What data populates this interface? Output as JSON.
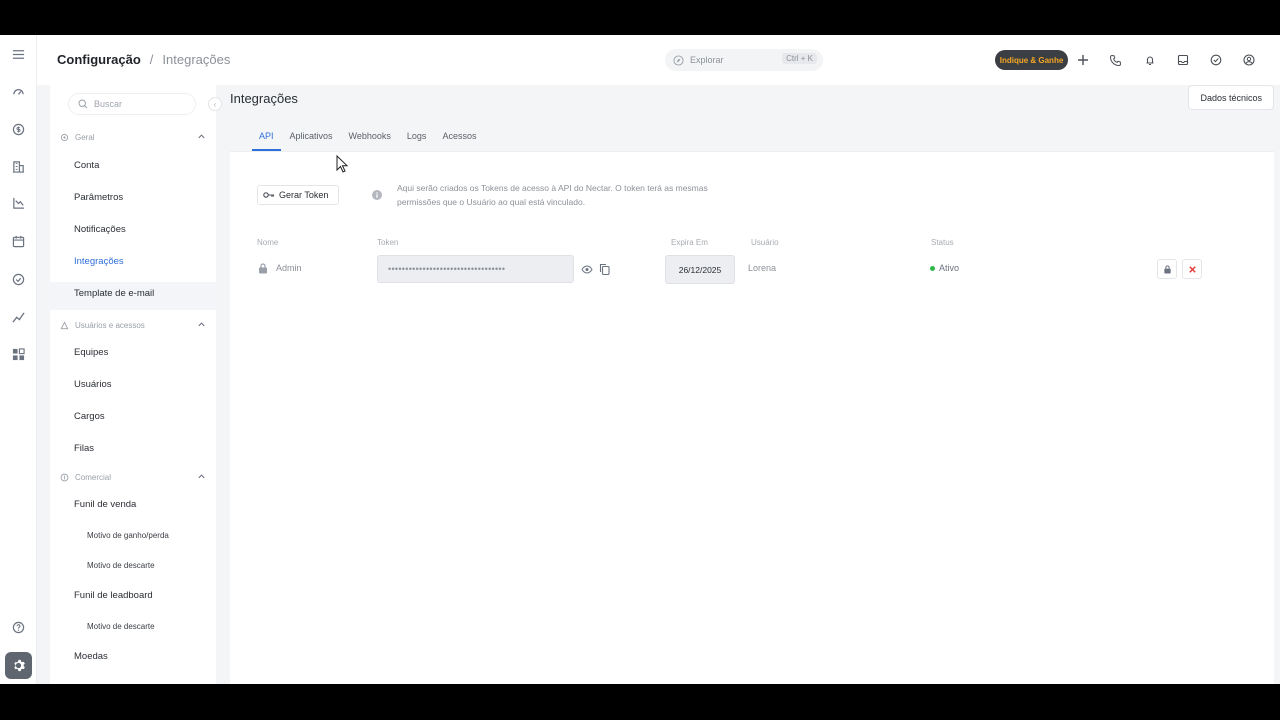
{
  "breadcrumb": {
    "parent": "Configuração",
    "separator": "/",
    "current": "Integrações"
  },
  "topbar": {
    "search_placeholder": "Explorar",
    "search_shortcut": "Ctrl + K",
    "indique_label": "Indique & Ganhe",
    "icons": [
      "plus-icon",
      "phone-icon",
      "bell-icon",
      "inbox-icon",
      "task-check-icon",
      "user-avatar-icon"
    ]
  },
  "rail": {
    "icons": [
      "menu-icon",
      "dashboard-icon",
      "money-icon",
      "building-icon",
      "chart-icon",
      "calendar-icon",
      "check-circle-icon",
      "trend-icon",
      "widgets-icon",
      "help-icon",
      "settings-icon"
    ]
  },
  "sidebar": {
    "search_placeholder": "Buscar",
    "sections": {
      "geral": "Geral",
      "usuarios": "Usuários e acessos",
      "comercial": "Comercial"
    },
    "items": {
      "conta": "Conta",
      "parametros": "Parâmetros",
      "notificacoes": "Notificações",
      "integracoes": "Integrações",
      "template": "Template de e-mail",
      "equipes": "Equipes",
      "usuarios": "Usuários",
      "cargos": "Cargos",
      "filas": "Filas",
      "funil_venda": "Funil de venda",
      "motivo_ganho": "Motivo de ganho/perda",
      "motivo_descarte": "Motivo de descarte",
      "funil_leadboard": "Funil de leadboard",
      "motivo_descarte_2": "Motivo de descarte",
      "moedas": "Moedas"
    }
  },
  "main": {
    "title": "Integrações",
    "dados_button": "Dados técnicos",
    "tabs": [
      "API",
      "Aplicativos",
      "Webhooks",
      "Logs",
      "Acessos"
    ],
    "active_tab": "API",
    "gerar_token": "Gerar Token",
    "info_text": "Aqui serão criados os Tokens de acesso à API do Nectar. O token terá as mesmas permissões que o Usuário ao qual está vinculado.",
    "table": {
      "headers": {
        "nome": "Nome",
        "token": "Token",
        "expira": "Expira Em",
        "usuario": "Usuário",
        "status": "Status"
      },
      "rows": [
        {
          "nome": "Admin",
          "token": "••••••••••••••••••••••••••••••••••",
          "expira": "26/12/2025",
          "usuario": "Lorena",
          "status": "Ativo"
        }
      ]
    }
  },
  "colors": {
    "accent": "#2f6fdb",
    "status_active": "#2db84c",
    "delete": "#e53935"
  }
}
